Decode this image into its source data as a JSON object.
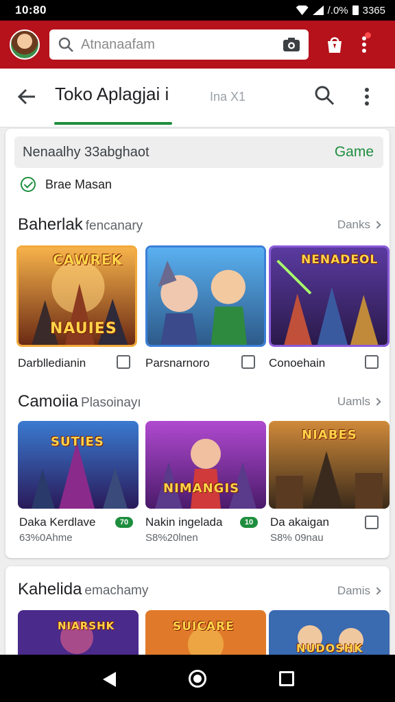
{
  "status_bar": {
    "time": "10:80",
    "right_text": "/.0%",
    "battery_text": "3365"
  },
  "top_bar": {
    "search_placeholder": "Atnanaafam"
  },
  "app_bar": {
    "title": "Toko Aplagjai i",
    "secondary": "Ina X1"
  },
  "filter": {
    "text": "Nenaalhy 33abghaot",
    "category": "Game"
  },
  "verified": {
    "label": "Brae Masan"
  },
  "sections": [
    {
      "title": "Baherlak",
      "subtitle": "fencanary",
      "more": "Danks",
      "items": [
        {
          "name": "Darblledianin",
          "overlay_top": "CAWREK",
          "overlay_bottom": "NAUIES"
        },
        {
          "name": "Parsnarnoro"
        },
        {
          "name": "Conoehain",
          "overlay_top": "NENADEOL"
        }
      ]
    },
    {
      "title": "Camoiia",
      "subtitle": "Plasoinayı",
      "more": "Uamls",
      "items": [
        {
          "name": "Daka Kerdlave",
          "sub": "63%0Ahme",
          "badge": "70",
          "overlay_top": "SUTIES"
        },
        {
          "name": "Nakin ingelada",
          "sub": "S8%20lnen",
          "badge": "10",
          "overlay_top": "NIMANGIS"
        },
        {
          "name": "Da akaigan",
          "sub": "S8% 09nau",
          "overlay_top": "NIABES"
        }
      ]
    },
    {
      "title": "Kahelida",
      "subtitle": "emachamy",
      "more": "Damis",
      "items": [
        {
          "overlay_top": "NIARSHK"
        },
        {
          "overlay_top": "SUICARE"
        },
        {
          "overlay_top": "NUDOSHK"
        }
      ]
    }
  ]
}
